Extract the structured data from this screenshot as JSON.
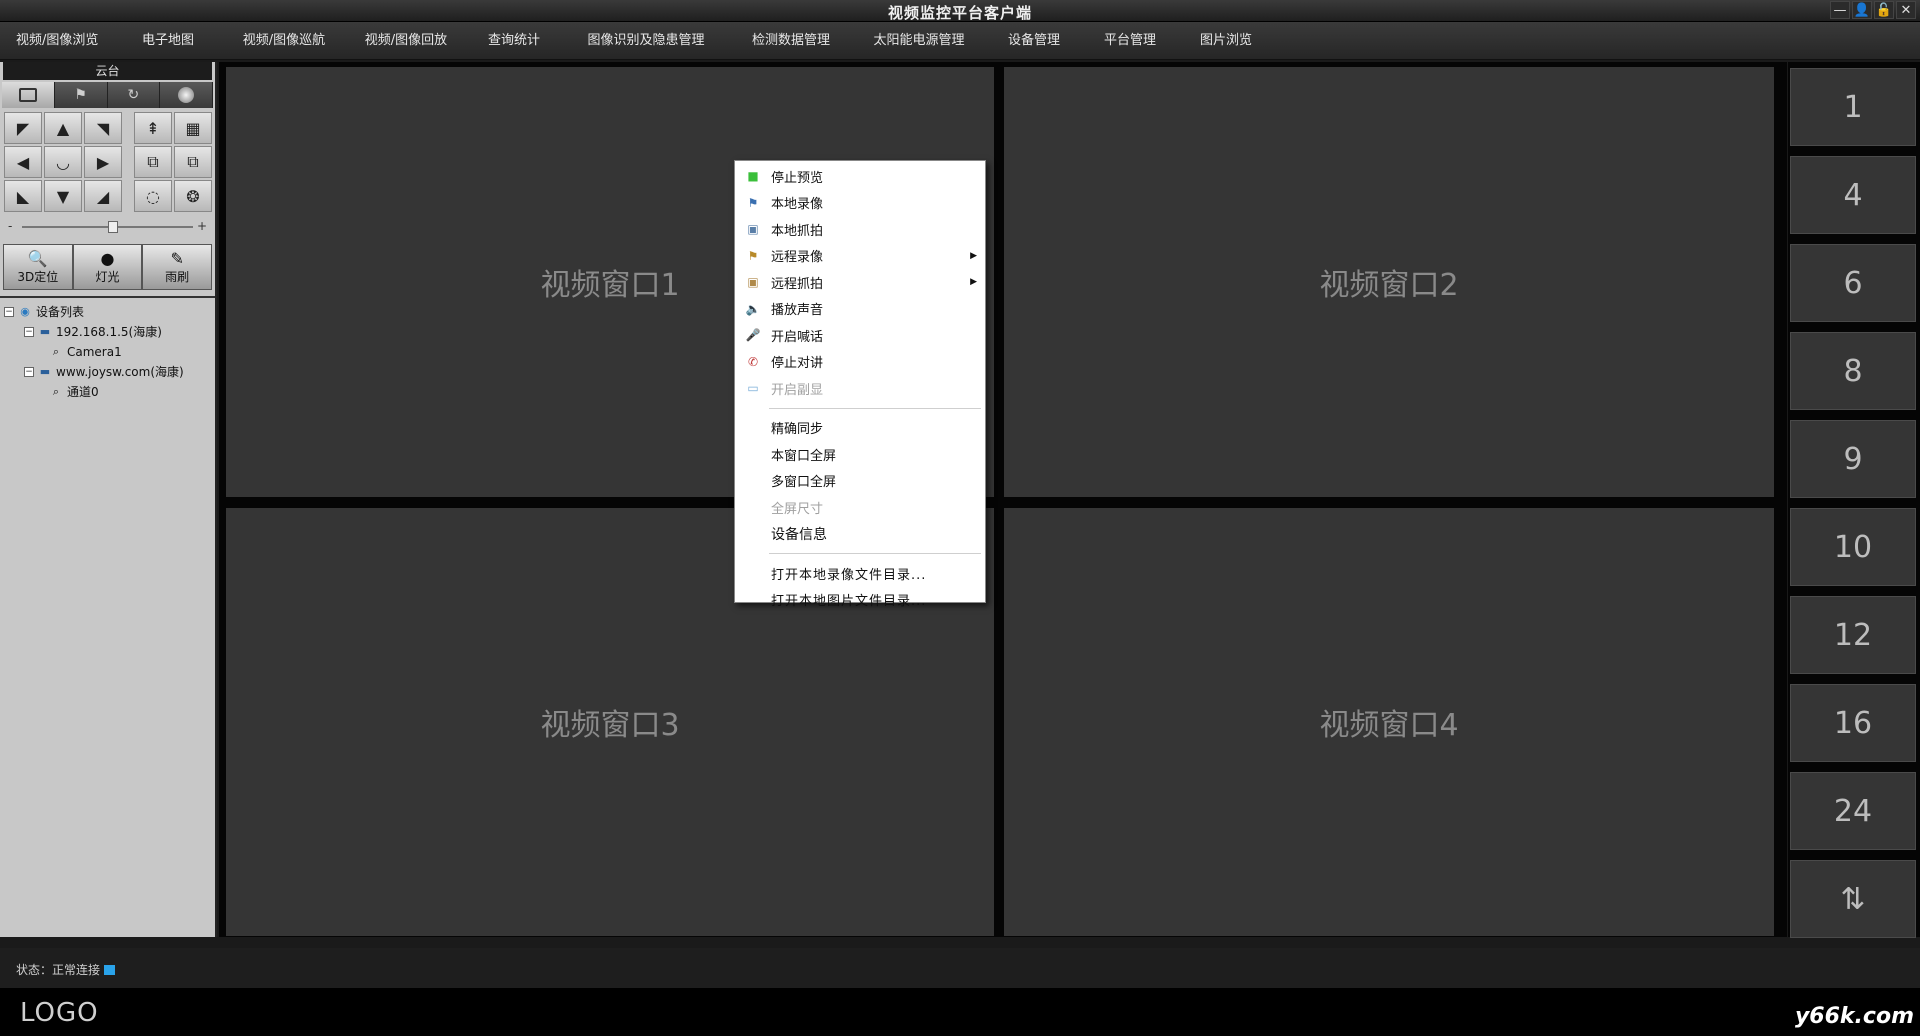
{
  "window": {
    "title": "视频监控平台客户端",
    "controls": [
      "—",
      "👤",
      "🔓",
      "✕"
    ]
  },
  "menu": [
    "视频/图像浏览",
    "电子地图",
    "视频/图像巡航",
    "视频/图像回放",
    "查询统计",
    "图像识别及隐患管理",
    "检测数据管理",
    "太阳能电源管理",
    "设备管理",
    "平台管理",
    "图片浏览"
  ],
  "ptz": {
    "title": "云台",
    "grid": [
      "◤",
      "▲",
      "◥",
      "⇞",
      "▦",
      "◀",
      "◡",
      "▶",
      "⧉",
      "⧉",
      "◣",
      "▼",
      "◢",
      "◌",
      "❂"
    ],
    "slider_min": "-",
    "slider_max": "+",
    "functions": [
      {
        "icon": "🔍",
        "label": "3D定位"
      },
      {
        "icon": "●",
        "label": "灯光"
      },
      {
        "icon": "✎",
        "label": "雨刷"
      }
    ]
  },
  "tree": {
    "root": "设备列表",
    "nodes": [
      {
        "label": "192.168.1.5(海康)",
        "child": "Camera1"
      },
      {
        "label": "www.joysw.com(海康)",
        "child": "通道0"
      }
    ]
  },
  "video_windows": [
    "视频窗口1",
    "视频窗口2",
    "视频窗口3",
    "视频窗口4"
  ],
  "layouts": [
    "1",
    "4",
    "6",
    "8",
    "9",
    "10",
    "12",
    "16",
    "24",
    "⇅"
  ],
  "status": {
    "text": "状态：正常连接",
    "indicator_color": "#2aa3ea"
  },
  "footer": {
    "logo": "LOGO",
    "watermark": "y66k.com"
  },
  "context_menu": {
    "group1": [
      {
        "label": "停止预览",
        "icon": "■",
        "icon_color": "#3bbf3b",
        "disabled": false,
        "submenu": false
      },
      {
        "label": "本地录像",
        "icon": "⚑",
        "icon_color": "#3a6fb0",
        "disabled": false,
        "submenu": false
      },
      {
        "label": "本地抓拍",
        "icon": "▣",
        "icon_color": "#5a7fa8",
        "disabled": false,
        "submenu": false
      },
      {
        "label": "远程录像",
        "icon": "⚑",
        "icon_color": "#b88a2a",
        "disabled": false,
        "submenu": true
      },
      {
        "label": "远程抓拍",
        "icon": "▣",
        "icon_color": "#b08a4a",
        "disabled": false,
        "submenu": true
      },
      {
        "label": "播放声音",
        "icon": "🔈",
        "icon_color": "#888888",
        "disabled": false,
        "submenu": false
      },
      {
        "label": "开启喊话",
        "icon": "🎤",
        "icon_color": "#555555",
        "disabled": false,
        "submenu": false
      },
      {
        "label": "停止对讲",
        "icon": "✆",
        "icon_color": "#c03a3a",
        "disabled": false,
        "submenu": false
      },
      {
        "label": "开启副显",
        "icon": "▭",
        "icon_color": "#7aaed8",
        "disabled": true,
        "submenu": false
      }
    ],
    "group2": [
      {
        "label": "精确同步",
        "disabled": false
      },
      {
        "label": "本窗口全屏",
        "disabled": false
      },
      {
        "label": "多窗口全屏",
        "disabled": false
      },
      {
        "label": "全屏尺寸",
        "disabled": true
      },
      {
        "label": "设备信息",
        "disabled": false
      }
    ],
    "group3": [
      {
        "label": "打开本地录像文件目录..."
      },
      {
        "label": "打开本地图片文件目录..."
      }
    ]
  }
}
